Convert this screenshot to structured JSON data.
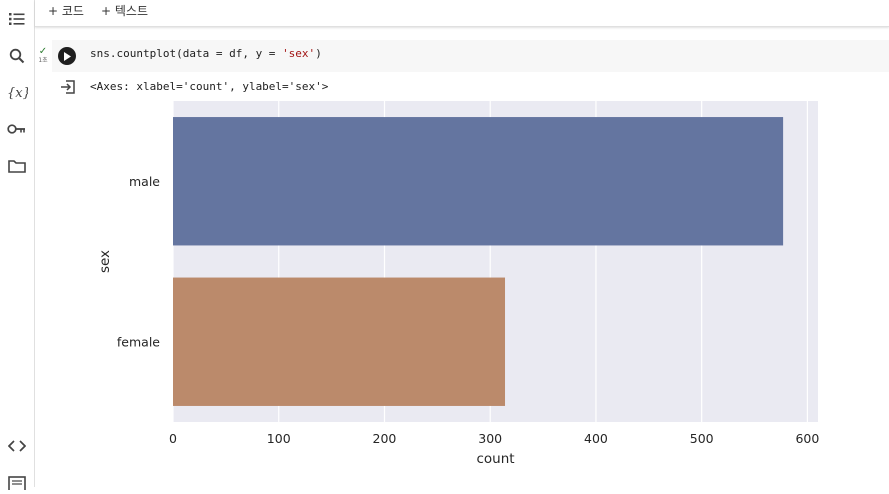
{
  "toolbar": {
    "add_code_label": "+ 코드",
    "add_text_label": "+ 텍스트"
  },
  "sidebar": {
    "items": [
      {
        "icon": "table-of-contents-icon"
      },
      {
        "icon": "search-icon"
      },
      {
        "icon": "variables-icon"
      },
      {
        "icon": "key-icon"
      },
      {
        "icon": "folder-icon"
      }
    ],
    "bottom_items": [
      {
        "icon": "code-snippets-icon"
      },
      {
        "icon": "terminal-icon"
      }
    ]
  },
  "cell": {
    "code_prefix": "sns.countplot(data = df, y = ",
    "code_string": "'sex'",
    "code_suffix": ")",
    "exec_status_check": "✓",
    "exec_time": "1초",
    "output_text": "<Axes: xlabel='count', ylabel='sex'>"
  },
  "chart_data": {
    "type": "bar",
    "orientation": "horizontal",
    "categories": [
      "male",
      "female"
    ],
    "values": [
      577,
      314
    ],
    "colors": [
      "#6475a0",
      "#bb8a6b"
    ],
    "xlabel": "count",
    "ylabel": "sex",
    "xlim": [
      0,
      610
    ],
    "xticks": [
      0,
      100,
      200,
      300,
      400,
      500,
      600
    ],
    "grid": true,
    "background": "#eaeaf2"
  }
}
